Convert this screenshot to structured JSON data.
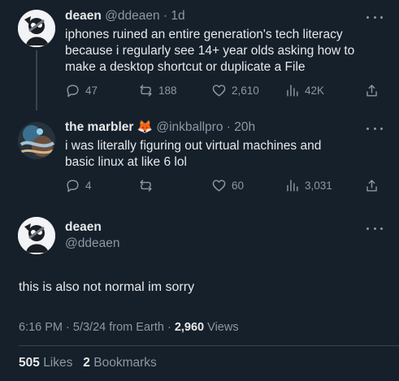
{
  "posts": [
    {
      "name": "deaen",
      "handle": "@ddeaen",
      "time": "1d",
      "text": "iphones ruined an entire generation's tech literacy\nbecause i regularly see 14+ year olds asking how to\nmake a desktop shortcut or duplicate a File",
      "replies": "47",
      "reposts": "188",
      "likes": "2,610",
      "views": "42K"
    },
    {
      "name": "the marbler",
      "emoji": "🦊",
      "handle": "@inkballpro",
      "time": "20h",
      "text": "i was literally figuring out virtual machines and\nbasic linux at like 6 lol",
      "replies": "4",
      "reposts": "",
      "likes": "60",
      "views": "3,031"
    }
  ],
  "focus": {
    "name": "deaen",
    "handle": "@ddeaen",
    "text": "this is also not normal im sorry",
    "time": "6:16 PM",
    "date": "5/3/24",
    "source": "from Earth",
    "views_count": "2,960",
    "views_label": "Views",
    "likes_count": "505",
    "likes_label": "Likes",
    "bookmarks_count": "2",
    "bookmarks_label": "Bookmarks"
  },
  "icons": {
    "reply": "reply-icon",
    "repost": "repost-icon",
    "like": "heart-icon",
    "views": "views-bar-icon",
    "share": "share-icon",
    "more": "more-dots-icon"
  },
  "colors": {
    "background": "#15202b",
    "text": "#e7e9ea",
    "muted": "#8b98a5",
    "divider": "#38444d"
  }
}
